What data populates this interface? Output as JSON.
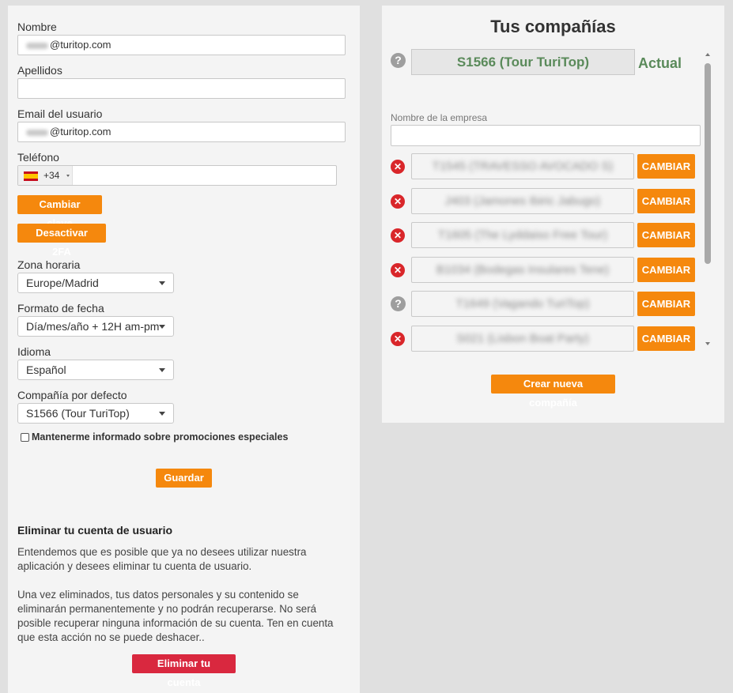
{
  "profile": {
    "nombre_label": "Nombre",
    "nombre_value": "@turitop.com",
    "apellidos_label": "Apellidos",
    "apellidos_value": "",
    "email_label": "Email del usuario",
    "email_value": "@turitop.com",
    "telefono_label": "Teléfono",
    "telefono_code": "+34",
    "cambiar_clave": "Cambiar clave",
    "desactivar_2fa": "Desactivar 2FA",
    "zona_label": "Zona horaria",
    "zona_value": "Europe/Madrid",
    "formato_label": "Formato de fecha",
    "formato_value": "Día/mes/año + 12H am-pm",
    "idioma_label": "Idioma",
    "idioma_value": "Español",
    "compania_label": "Compañía por defecto",
    "compania_value": "S1566 (Tour TuriTop)",
    "promo_label": "Mantenerme informado sobre promociones especiales",
    "guardar": "Guardar"
  },
  "delete_account": {
    "title": "Eliminar tu cuenta de usuario",
    "para1": "Entendemos que es posible que ya no desees utilizar nuestra aplicación y desees eliminar tu cuenta de usuario.",
    "para2": "Una vez eliminados, tus datos personales y su contenido se eliminarán permanentemente y no podrán recuperarse. No será posible recuperar ninguna información de su cuenta. Ten en cuenta que esta acción no se puede deshacer..",
    "button": "Eliminar tu cuenta"
  },
  "companies": {
    "title": "Tus compañías",
    "current_name": "S1566 (Tour TuriTop)",
    "current_label": "Actual",
    "empresa_label": "Nombre de la empresa",
    "empresa_value": "",
    "change_label": "CAMBIAR",
    "create_button": "Crear nueva compañía",
    "list": [
      {
        "name": "T1545 (TRAVESSO AVOCADO S)",
        "icon": "remove-icon"
      },
      {
        "name": "J403 (Jamones Ibiric Jabugo)",
        "icon": "remove-icon"
      },
      {
        "name": "T1605 (The Lyddaiso Free Tour)",
        "icon": "remove-icon"
      },
      {
        "name": "B1034 (Bodegas Insulares Tene)",
        "icon": "remove-icon"
      },
      {
        "name": "T1649 (Vagando TuriTop)",
        "icon": "question-icon"
      },
      {
        "name": "S021 (Lisbon Boat Party)",
        "icon": "remove-icon"
      }
    ]
  },
  "colors": {
    "accent": "#f5880d",
    "danger": "#d9283f",
    "current_green": "#5a8a5a"
  }
}
